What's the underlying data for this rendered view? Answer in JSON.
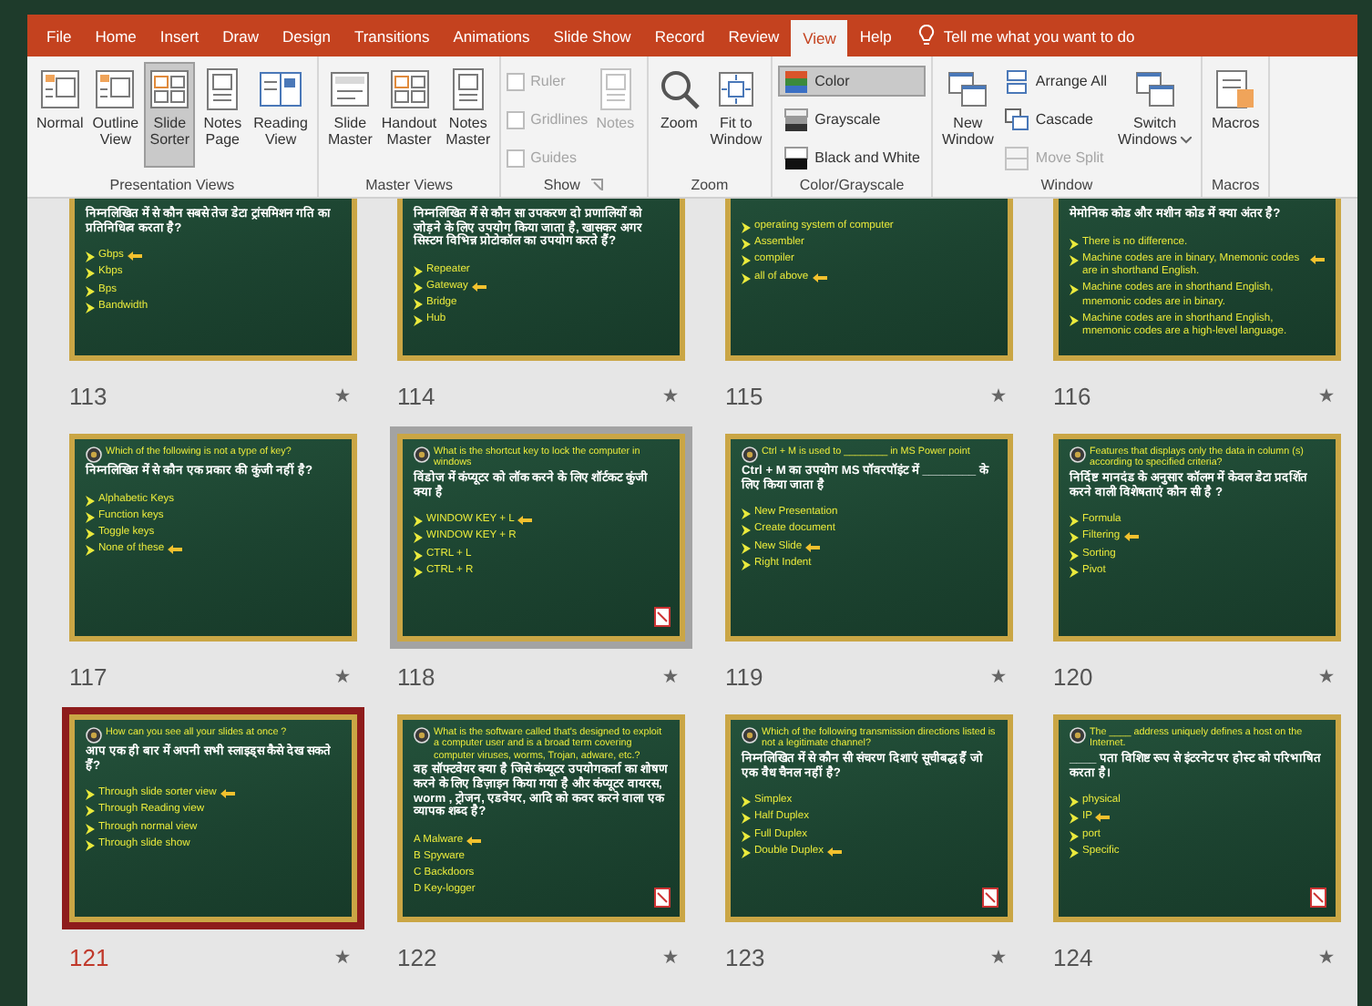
{
  "tabs": [
    {
      "label": "File",
      "selected": false
    },
    {
      "label": "Home",
      "selected": false
    },
    {
      "label": "Insert",
      "selected": false
    },
    {
      "label": "Draw",
      "selected": false
    },
    {
      "label": "Design",
      "selected": false
    },
    {
      "label": "Transitions",
      "selected": false
    },
    {
      "label": "Animations",
      "selected": false
    },
    {
      "label": "Slide Show",
      "selected": false
    },
    {
      "label": "Record",
      "selected": false
    },
    {
      "label": "Review",
      "selected": false
    },
    {
      "label": "View",
      "selected": true
    },
    {
      "label": "Help",
      "selected": false
    }
  ],
  "tell_me": "Tell me what you want to do",
  "ribbon_groups": [
    {
      "label": "Presentation Views",
      "items": [
        {
          "kind": "large",
          "label": "Normal",
          "selected": false,
          "disabled": false
        },
        {
          "kind": "large",
          "label": "Outline\nView",
          "selected": false,
          "disabled": false
        },
        {
          "kind": "large",
          "label": "Slide\nSorter",
          "selected": true,
          "disabled": false
        },
        {
          "kind": "large",
          "label": "Notes\nPage",
          "selected": false,
          "disabled": false
        },
        {
          "kind": "large",
          "label": "Reading\nView",
          "selected": false,
          "disabled": false
        }
      ]
    },
    {
      "label": "Master Views",
      "items": [
        {
          "kind": "large",
          "label": "Slide\nMaster",
          "selected": false,
          "disabled": false
        },
        {
          "kind": "large",
          "label": "Handout\nMaster",
          "selected": false,
          "disabled": false
        },
        {
          "kind": "large",
          "label": "Notes\nMaster",
          "selected": false,
          "disabled": false
        }
      ]
    },
    {
      "label": "Show",
      "launcher": true,
      "items": [
        {
          "kind": "check",
          "label": "Ruler",
          "checked": false,
          "disabled": true
        },
        {
          "kind": "check",
          "label": "Gridlines",
          "checked": false,
          "disabled": true
        },
        {
          "kind": "check",
          "label": "Guides",
          "checked": false,
          "disabled": true
        },
        {
          "kind": "large",
          "label": "Notes",
          "selected": false,
          "disabled": true
        }
      ]
    },
    {
      "label": "Zoom",
      "items": [
        {
          "kind": "large",
          "label": "Zoom",
          "selected": false,
          "disabled": false
        },
        {
          "kind": "large",
          "label": "Fit to\nWindow",
          "selected": false,
          "disabled": false
        }
      ]
    },
    {
      "label": "Color/Grayscale",
      "items": [
        {
          "kind": "small",
          "label": "Color",
          "selected": true
        },
        {
          "kind": "small",
          "label": "Grayscale",
          "selected": false
        },
        {
          "kind": "small",
          "label": "Black and White",
          "selected": false
        }
      ]
    },
    {
      "label": "Window",
      "items": [
        {
          "kind": "large",
          "label": "New\nWindow",
          "selected": false,
          "disabled": false
        },
        {
          "kind": "small",
          "label": "Arrange All",
          "disabled": false
        },
        {
          "kind": "small",
          "label": "Cascade",
          "disabled": false
        },
        {
          "kind": "small",
          "label": "Move Split",
          "disabled": true
        },
        {
          "kind": "large",
          "label": "Switch\nWindows",
          "selected": false,
          "disabled": false,
          "dropdown": true
        }
      ]
    },
    {
      "label": "Macros",
      "items": [
        {
          "kind": "large",
          "label": "Macros",
          "selected": false,
          "disabled": false
        }
      ]
    }
  ],
  "slides": [
    {
      "number": "113",
      "selected": false,
      "hovered": false,
      "logo": false,
      "media": false,
      "bullets": true,
      "hindi": "निम्नलिखित में से कौन सबसे तेज डेटा ट्रांसमिशन गति का प्रतिनिधित्व करता है?",
      "options": [
        {
          "text": "Gbps",
          "marked": true
        },
        {
          "text": "Kbps",
          "marked": false
        },
        {
          "text": "Bps",
          "marked": false
        },
        {
          "text": "Bandwidth",
          "marked": false
        }
      ]
    },
    {
      "number": "114",
      "selected": false,
      "hovered": false,
      "logo": false,
      "media": false,
      "bullets": true,
      "hindi": "निम्नलिखित में से कौन सा उपकरण दो प्रणालियों को जोड़ने के लिए उपयोग किया जाता है, खासकर अगर सिस्टम विभिन्न प्रोटोकॉल का उपयोग करते हैं?",
      "options": [
        {
          "text": "Repeater",
          "marked": false
        },
        {
          "text": "Gateway",
          "marked": true
        },
        {
          "text": "Bridge",
          "marked": false
        },
        {
          "text": "Hub",
          "marked": false
        }
      ]
    },
    {
      "number": "115",
      "selected": false,
      "hovered": false,
      "logo": false,
      "media": false,
      "bullets": true,
      "options": [
        {
          "text": "operating system of computer",
          "marked": false
        },
        {
          "text": "Assembler",
          "marked": false
        },
        {
          "text": "compiler",
          "marked": false
        },
        {
          "text": "all of above",
          "marked": true
        }
      ]
    },
    {
      "number": "116",
      "selected": false,
      "hovered": false,
      "logo": false,
      "media": false,
      "bullets": true,
      "hindi": "मेमोनिक कोड और मशीन कोड में क्या अंतर है?",
      "options": [
        {
          "text": "There is no difference.",
          "marked": false
        },
        {
          "text": "Machine codes are in binary, Mnemonic codes are in shorthand English.",
          "marked": true
        },
        {
          "text": "Machine codes are in shorthand English, mnemonic codes are in binary.",
          "marked": false
        },
        {
          "text": "Machine codes are in shorthand English, mnemonic codes are a high-level language.",
          "marked": false
        }
      ]
    },
    {
      "number": "117",
      "selected": false,
      "hovered": false,
      "logo": true,
      "media": false,
      "bullets": true,
      "english": "Which of the following is not a type of key?",
      "hindi": "निम्नलिखित में से कौन एक प्रकार की कुंजी नहीं है?",
      "options": [
        {
          "text": "Alphabetic Keys",
          "marked": false
        },
        {
          "text": "Function keys",
          "marked": false
        },
        {
          "text": "Toggle keys",
          "marked": false
        },
        {
          "text": "None of these",
          "marked": true
        }
      ]
    },
    {
      "number": "118",
      "selected": false,
      "hovered": true,
      "logo": true,
      "media": true,
      "bullets": true,
      "english": "What is the shortcut key to lock the computer in windows",
      "hindi": "विंडोज में कंप्यूटर को लॉक करने के लिए शॉर्टकट कुंजी क्या है",
      "options": [
        {
          "text": "WINDOW KEY + L",
          "marked": true
        },
        {
          "text": "WINDOW KEY + R",
          "marked": false
        },
        {
          "text": "CTRL + L",
          "marked": false
        },
        {
          "text": "CTRL + R",
          "marked": false
        }
      ]
    },
    {
      "number": "119",
      "selected": false,
      "hovered": false,
      "logo": true,
      "media": false,
      "bullets": true,
      "english": "Ctrl + M is used to ________ in MS Power point",
      "hindi": "Ctrl + M का उपयोग MS पॉवरपॉइंट में ________ के लिए किया जाता है",
      "options": [
        {
          "text": "New Presentation",
          "marked": false
        },
        {
          "text": "Create document",
          "marked": false
        },
        {
          "text": "New Slide",
          "marked": true
        },
        {
          "text": "Right Indent",
          "marked": false
        }
      ]
    },
    {
      "number": "120",
      "selected": false,
      "hovered": false,
      "logo": true,
      "media": false,
      "bullets": true,
      "english": "Features that displays only the data in column (s) according to specified criteria?",
      "hindi": "निर्दिष्ट मानदंड के अनुसार कॉलम में केवल डेटा प्रदर्शित करने वाली विशेषताएं कौन सी है ?",
      "options": [
        {
          "text": "Formula",
          "marked": false
        },
        {
          "text": "Filtering",
          "marked": true
        },
        {
          "text": "Sorting",
          "marked": false
        },
        {
          "text": "Pivot",
          "marked": false
        }
      ]
    },
    {
      "number": "121",
      "selected": true,
      "hovered": false,
      "logo": true,
      "media": false,
      "bullets": true,
      "english": "How can you see all your slides at once ?",
      "hindi": "आप एक ही बार में अपनी सभी स्लाइड्स कैसे देख सकते हैं?",
      "options": [
        {
          "text": "Through slide sorter view",
          "marked": true
        },
        {
          "text": "Through Reading view",
          "marked": false
        },
        {
          "text": "Through normal view",
          "marked": false
        },
        {
          "text": "Through slide show",
          "marked": false
        }
      ]
    },
    {
      "number": "122",
      "selected": false,
      "hovered": false,
      "logo": true,
      "media": true,
      "bullets": false,
      "english": "What is the software called that's designed to exploit a computer user and is a broad term covering computer viruses, worms, Trojan, adware, etc.?",
      "hindi": "वह सॉफ्टवेयर क्या है जिसे कंप्यूटर उपयोगकर्ता का शोषण करने के लिए डिज़ाइन किया गया है और कंप्यूटर वायरस, worm , ट्रोजन, एडवेयर, आदि को कवर करने वाला एक व्यापक शब्द है?",
      "options": [
        {
          "text": "A Malware",
          "marked": true
        },
        {
          "text": "B Spyware",
          "marked": false
        },
        {
          "text": "C Backdoors",
          "marked": false
        },
        {
          "text": "D Key-logger",
          "marked": false
        }
      ]
    },
    {
      "number": "123",
      "selected": false,
      "hovered": false,
      "logo": true,
      "media": true,
      "bullets": true,
      "english": "Which of the following transmission directions listed is not a legitimate channel?",
      "hindi": "निम्नलिखित में से कौन सी संचरण दिशाएं सूचीबद्ध हैं जो एक वैध चैनल नहीं है?",
      "options": [
        {
          "text": "Simplex",
          "marked": false
        },
        {
          "text": "Half Duplex",
          "marked": false
        },
        {
          "text": "Full Duplex",
          "marked": false
        },
        {
          "text": "Double Duplex",
          "marked": true
        }
      ]
    },
    {
      "number": "124",
      "selected": false,
      "hovered": false,
      "logo": true,
      "media": true,
      "bullets": true,
      "english": "The ____ address uniquely defines a host on the Internet.",
      "hindi": "____ पता विशिष्ट रूप से इंटरनेट पर होस्ट को परिभाषित करता है।",
      "options": [
        {
          "text": "physical",
          "marked": false
        },
        {
          "text": "IP",
          "marked": true
        },
        {
          "text": "port",
          "marked": false
        },
        {
          "text": "Specific",
          "marked": false
        }
      ]
    }
  ]
}
